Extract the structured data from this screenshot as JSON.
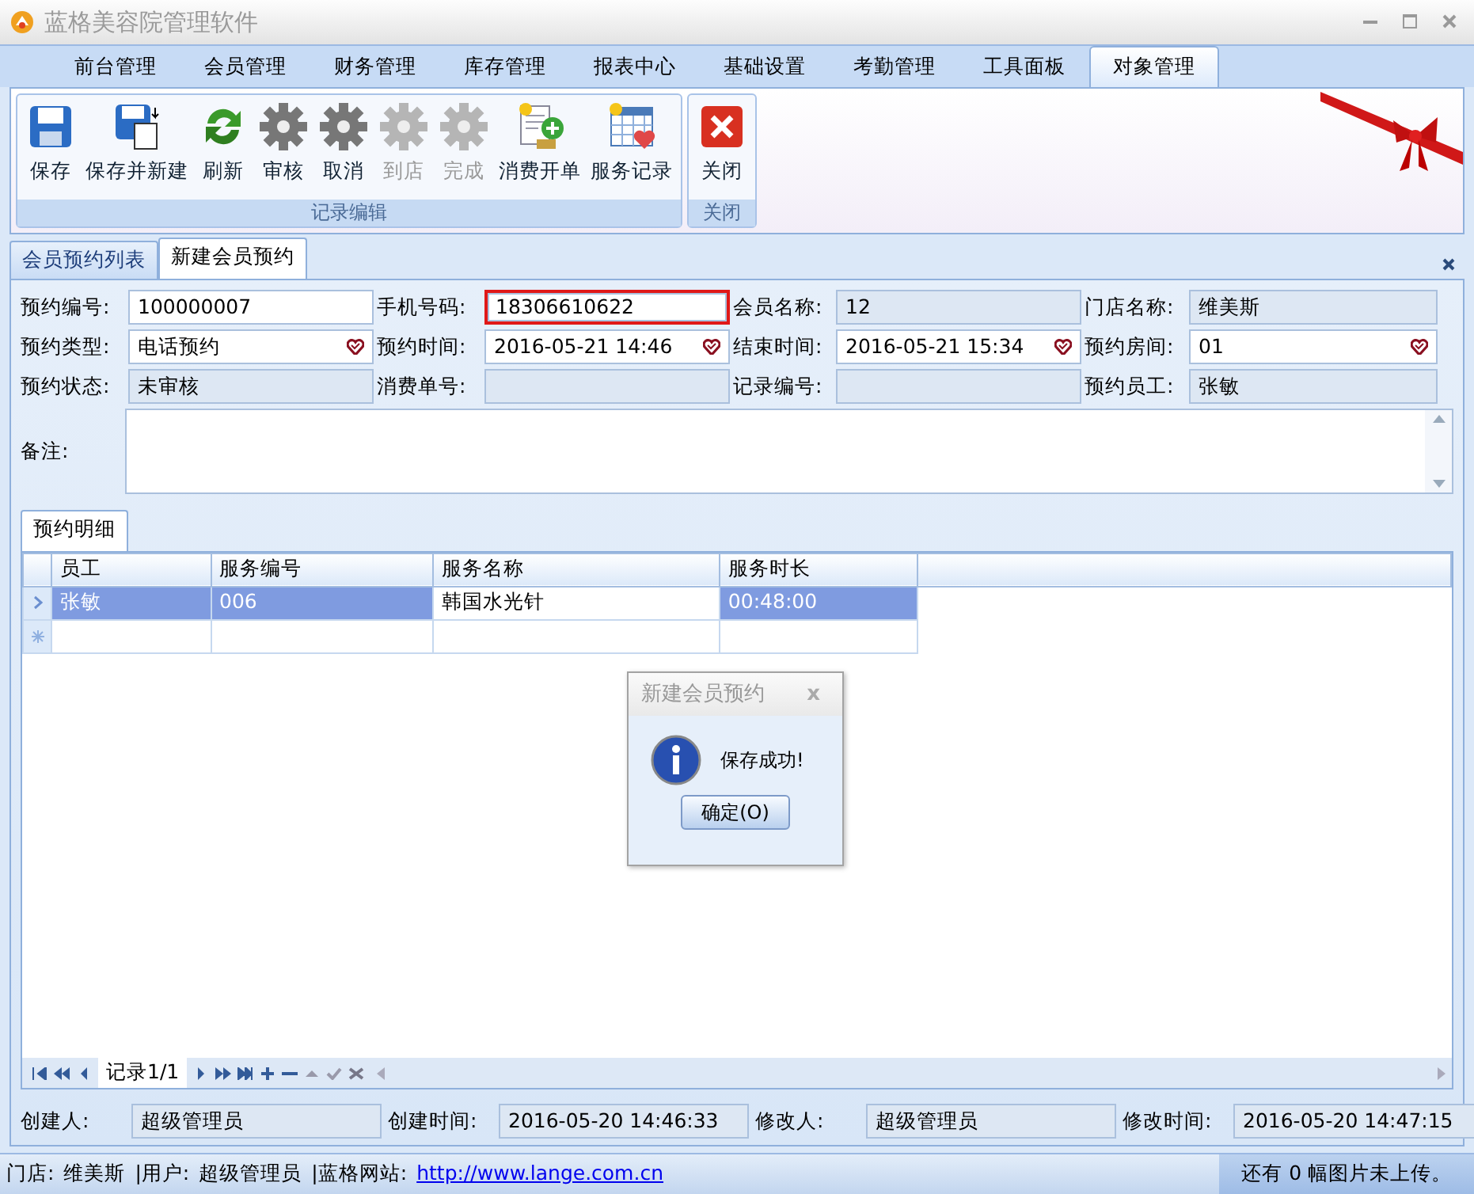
{
  "window": {
    "title": "蓝格美容院管理软件"
  },
  "ribbon_tabs": [
    {
      "label": "前台管理",
      "selected": false
    },
    {
      "label": "会员管理",
      "selected": false
    },
    {
      "label": "财务管理",
      "selected": false
    },
    {
      "label": "库存管理",
      "selected": false
    },
    {
      "label": "报表中心",
      "selected": false
    },
    {
      "label": "基础设置",
      "selected": false
    },
    {
      "label": "考勤管理",
      "selected": false
    },
    {
      "label": "工具面板",
      "selected": false
    },
    {
      "label": "对象管理",
      "selected": true
    }
  ],
  "ribbon_groups": [
    {
      "title": "记录编辑",
      "buttons": [
        {
          "label": "保存",
          "kind": "save",
          "disabled": false
        },
        {
          "label": "保存并新建",
          "kind": "savenew",
          "disabled": false
        },
        {
          "label": "刷新",
          "kind": "refresh",
          "disabled": false
        },
        {
          "label": "审核",
          "kind": "gear",
          "disabled": false
        },
        {
          "label": "取消",
          "kind": "gear",
          "disabled": false
        },
        {
          "label": "到店",
          "kind": "gear",
          "disabled": true
        },
        {
          "label": "完成",
          "kind": "gear",
          "disabled": true
        },
        {
          "label": "消费开单",
          "kind": "bill",
          "disabled": false
        },
        {
          "label": "服务记录",
          "kind": "calendar",
          "disabled": false
        }
      ]
    },
    {
      "title": "关闭",
      "buttons": [
        {
          "label": "关闭",
          "kind": "close",
          "disabled": false
        }
      ]
    }
  ],
  "doc_tabs": [
    {
      "label": "会员预约列表",
      "selected": false
    },
    {
      "label": "新建会员预约",
      "selected": true
    }
  ],
  "form": {
    "fields": [
      {
        "label": "预约编号:",
        "value": "100000007",
        "kind": "input",
        "highlighted": false
      },
      {
        "label": "手机号码:",
        "value": "18306610622",
        "kind": "input",
        "highlighted": true
      },
      {
        "label": "会员名称:",
        "value": "12",
        "kind": "readonly",
        "highlighted": false
      },
      {
        "label": "门店名称:",
        "value": "维美斯",
        "kind": "readonly",
        "highlighted": false
      },
      {
        "label": "预约类型:",
        "value": "电话预约",
        "kind": "select",
        "highlighted": false
      },
      {
        "label": "预约时间:",
        "value": "2016-05-21 14:46",
        "kind": "select",
        "highlighted": false
      },
      {
        "label": "结束时间:",
        "value": "2016-05-21 15:34",
        "kind": "select",
        "highlighted": false
      },
      {
        "label": "预约房间:",
        "value": "01",
        "kind": "select",
        "highlighted": false
      },
      {
        "label": "预约状态:",
        "value": "未审核",
        "kind": "readonly",
        "highlighted": false
      },
      {
        "label": "消费单号:",
        "kind": "readonly",
        "highlighted": false
      },
      {
        "label": "记录编号:",
        "kind": "readonly",
        "highlighted": false
      },
      {
        "label": "预约员工:",
        "value": "张敏",
        "kind": "readonly",
        "highlighted": false
      }
    ],
    "memo_label": "备注:"
  },
  "detail_tab": {
    "label": "预约明细",
    "selected": true
  },
  "grid": {
    "columns": [
      "员工",
      "服务编号",
      "服务名称",
      "服务时长"
    ],
    "rows": [
      {
        "selected": true,
        "cells": [
          {
            "text": "张敏",
            "focused": false
          },
          {
            "text": "006",
            "focused": false
          },
          {
            "text": "韩国水光针",
            "focused": true
          },
          {
            "text": "00:48:00",
            "focused": false
          }
        ]
      }
    ]
  },
  "navigator": {
    "record": "记录1/1"
  },
  "dialog": {
    "title": "新建会员预约",
    "close": "x",
    "message": "保存成功!",
    "button": "确定(O)"
  },
  "audit": [
    {
      "label": "创建人:",
      "value": "超级管理员"
    },
    {
      "label": "创建时间:",
      "value": "2016-05-20 14:46:33"
    },
    {
      "label": "修改人:",
      "value": "超级管理员"
    },
    {
      "label": "修改时间:",
      "value": "2016-05-20 14:47:15"
    }
  ],
  "status_bar": {
    "store_label": "门店:",
    "store": "维美斯",
    "user_label": "|用户:",
    "user": "超级管理员",
    "site_label": "|蓝格网站:",
    "site": "http://www.lange.com.cn",
    "upload": "还有 0 幅图片未上传。"
  }
}
